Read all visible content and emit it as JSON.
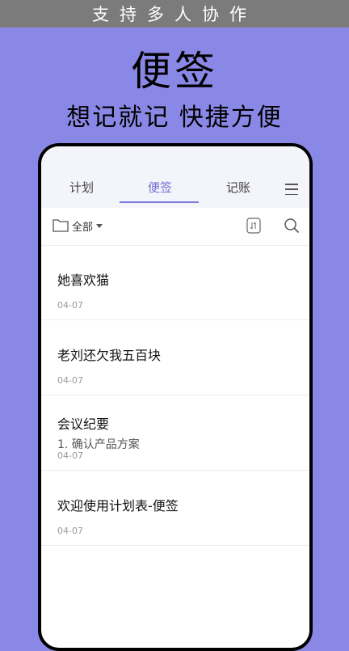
{
  "banner": {
    "text": "支持多人协作"
  },
  "hero": {
    "title": "便签",
    "subtitle": "想记就记 快捷方便"
  },
  "tabs": [
    {
      "label": "计划",
      "active": false
    },
    {
      "label": "便签",
      "active": true
    },
    {
      "label": "记账",
      "active": false
    }
  ],
  "toolbar": {
    "folder_label": "全部"
  },
  "notes": [
    {
      "title": "她喜欢猫",
      "body": "",
      "date": "04-07"
    },
    {
      "title": "老刘还欠我五百块",
      "body": "",
      "date": "04-07"
    },
    {
      "title": "会议纪要",
      "body": "1. 确认产品方案",
      "date": "04-07"
    },
    {
      "title": "欢迎使用计划表-便签",
      "body": "",
      "date": "04-07"
    }
  ],
  "colors": {
    "background": "#8a88e6",
    "accent": "#7a7adf",
    "banner": "#7b7b7b"
  }
}
